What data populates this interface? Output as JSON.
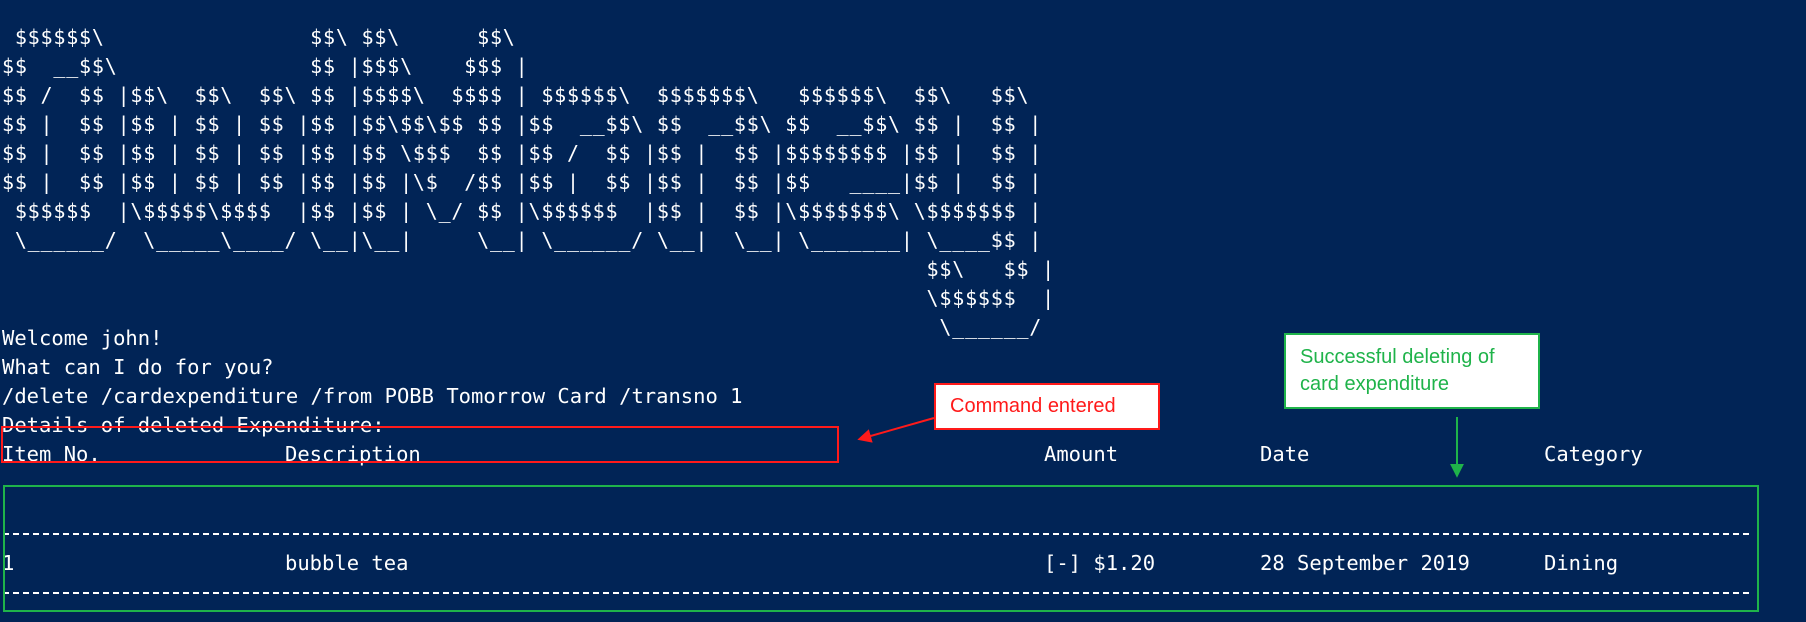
{
  "banner": {
    "ascii_art": " $$$$$$\\                $$\\ $$\\      $$\\\n$$  __$$\\               $$ |$$$\\    $$$ |\n$$ /  $$ |$$\\  $$\\  $$\\ $$ |$$$$\\  $$$$ | $$$$$$\\  $$$$$$$\\   $$$$$$\\  $$\\   $$\\\n$$ |  $$ |$$ | $$ | $$ |$$ |$$\\$$\\$$ $$ |$$  __$$\\ $$  __$$\\ $$  __$$\\ $$ |  $$ |\n$$ |  $$ |$$ | $$ | $$ |$$ |$$ \\$$$  $$ |$$ /  $$ |$$ |  $$ |$$$$$$$$ |$$ |  $$ |\n$$ |  $$ |$$ | $$ | $$ |$$ |$$ |\\$  /$$ |$$ |  $$ |$$ |  $$ |$$   ____|$$ |  $$ |\n $$$$$$  |\\$$$$$\\$$$$  |$$ |$$ | \\_/ $$ |\\$$$$$$  |$$ |  $$ |\\$$$$$$$\\ \\$$$$$$$ |\n \\______/  \\_____\\____/ \\__|\\__|     \\__| \\______/ \\__|  \\__| \\_______| \\____$$ |\n                                                                        $$\\   $$ |\n                                                                        \\$$$$$$  |\n                                                                         \\______/"
  },
  "console": {
    "welcome": "Welcome john!",
    "prompt": "What can I do for you?",
    "command": "/delete /cardexpenditure /from POBB Tomorrow Card /transno 1",
    "details_heading": "Details of deleted Expenditure:"
  },
  "table": {
    "headers": {
      "item_no": "Item No.",
      "description": "Description",
      "amount": "Amount",
      "date": "Date",
      "category": "Category"
    },
    "rows": [
      {
        "item_no": "1",
        "description": "bubble tea",
        "amount": "[-] $1.20",
        "date": "28 September 2019",
        "category": "Dining"
      }
    ]
  },
  "annotations": {
    "command_label": "Command entered",
    "success_label": "Successful deleting of\ncard expenditure"
  },
  "colors": {
    "terminal_background": "#012456",
    "terminal_text": "#ffffff",
    "command_highlight": "#ff1a1a",
    "result_highlight": "#1fb34a"
  }
}
